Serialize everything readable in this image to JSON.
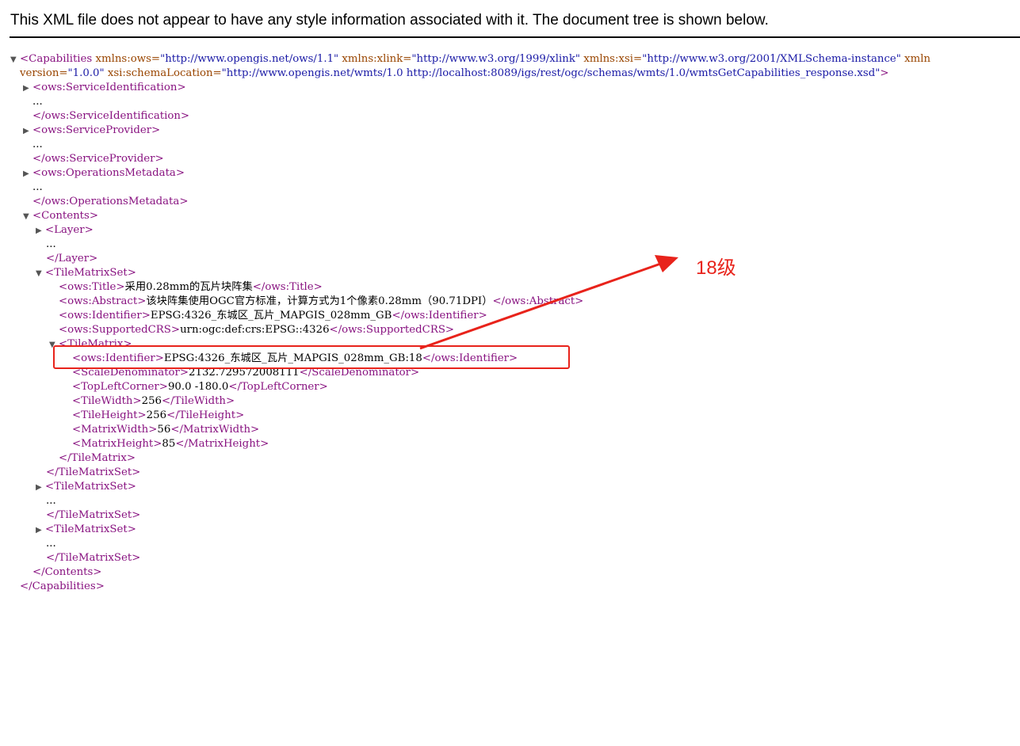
{
  "banner": {
    "message": "This XML file does not appear to have any style information associated with it. The document tree is shown below."
  },
  "xml": {
    "capabilities_open_1": "<Capabilities",
    "xmlns_ows_attr": "xmlns:ows=",
    "xmlns_ows_val": "\"http://www.opengis.net/ows/1.1\"",
    "xmlns_xlink_attr": "xmlns:xlink=",
    "xmlns_xlink_val": "\"http://www.w3.org/1999/xlink\"",
    "xmlns_xsi_attr": "xmlns:xsi=",
    "xmlns_xsi_val": "\"http://www.w3.org/2001/XMLSchema-instance\"",
    "xmlns_more": "xmln",
    "version_attr": "version=",
    "version_val": "\"1.0.0\"",
    "schema_attr": "xsi:schemaLocation=",
    "schema_val": "\"http://www.opengis.net/wmts/1.0 http://localhost:8089/igs/rest/ogc/schemas/wmts/1.0/wmtsGetCapabilities_response.xsd\"",
    "capabilities_open_end": ">",
    "service_identification_open": "<ows:ServiceIdentification>",
    "service_identification_close": "</ows:ServiceIdentification>",
    "service_provider_open": "<ows:ServiceProvider>",
    "service_provider_close": "</ows:ServiceProvider>",
    "operations_metadata_open": "<ows:OperationsMetadata>",
    "operations_metadata_close": "</ows:OperationsMetadata>",
    "ellipsis": "...",
    "contents_open": "<Contents>",
    "layer_open": "<Layer>",
    "layer_close": "</Layer>",
    "tms_open": "<TileMatrixSet>",
    "title_open": "<ows:Title>",
    "title_text": "采用0.28mm的瓦片块阵集",
    "title_close": "</ows:Title>",
    "abstract_open": "<ows:Abstract>",
    "abstract_text": "该块阵集使用OGC官方标准，计算方式为1个像素0.28mm（90.71DPI）",
    "abstract_close": "</ows:Abstract>",
    "identifier_open": "<ows:Identifier>",
    "tms_identifier_text": "EPSG:4326_东城区_瓦片_MAPGIS_028mm_GB",
    "identifier_close": "</ows:Identifier>",
    "crs_open": "<ows:SupportedCRS>",
    "crs_text": "urn:ogc:def:crs:EPSG::4326",
    "crs_close": "</ows:SupportedCRS>",
    "tm_open": "<TileMatrix>",
    "tm_identifier_text": "EPSG:4326_东城区_瓦片_MAPGIS_028mm_GB:18",
    "scale_open": "<ScaleDenominator>",
    "scale_text": "2132.729572008111",
    "scale_close": "</ScaleDenominator>",
    "tlc_open": "<TopLeftCorner>",
    "tlc_text": "90.0 -180.0",
    "tlc_close": "</TopLeftCorner>",
    "tw_open": "<TileWidth>",
    "tw_text": "256",
    "tw_close": "</TileWidth>",
    "th_open": "<TileHeight>",
    "th_text": "256",
    "th_close": "</TileHeight>",
    "mw_open": "<MatrixWidth>",
    "mw_text": "56",
    "mw_close": "</MatrixWidth>",
    "mh_open": "<MatrixHeight>",
    "mh_text": "85",
    "mh_close": "</MatrixHeight>",
    "tm_close": "</TileMatrix>",
    "tms_close": "</TileMatrixSet>",
    "contents_close": "</Contents>",
    "capabilities_close": "</Capabilities>"
  },
  "annotation": {
    "label": "18级",
    "color": "#e8231b"
  },
  "icons": {
    "expanded": "▼",
    "collapsed": "▶"
  },
  "colors": {
    "tag": "#881280",
    "attr": "#994500",
    "value": "#1a1aa6"
  }
}
